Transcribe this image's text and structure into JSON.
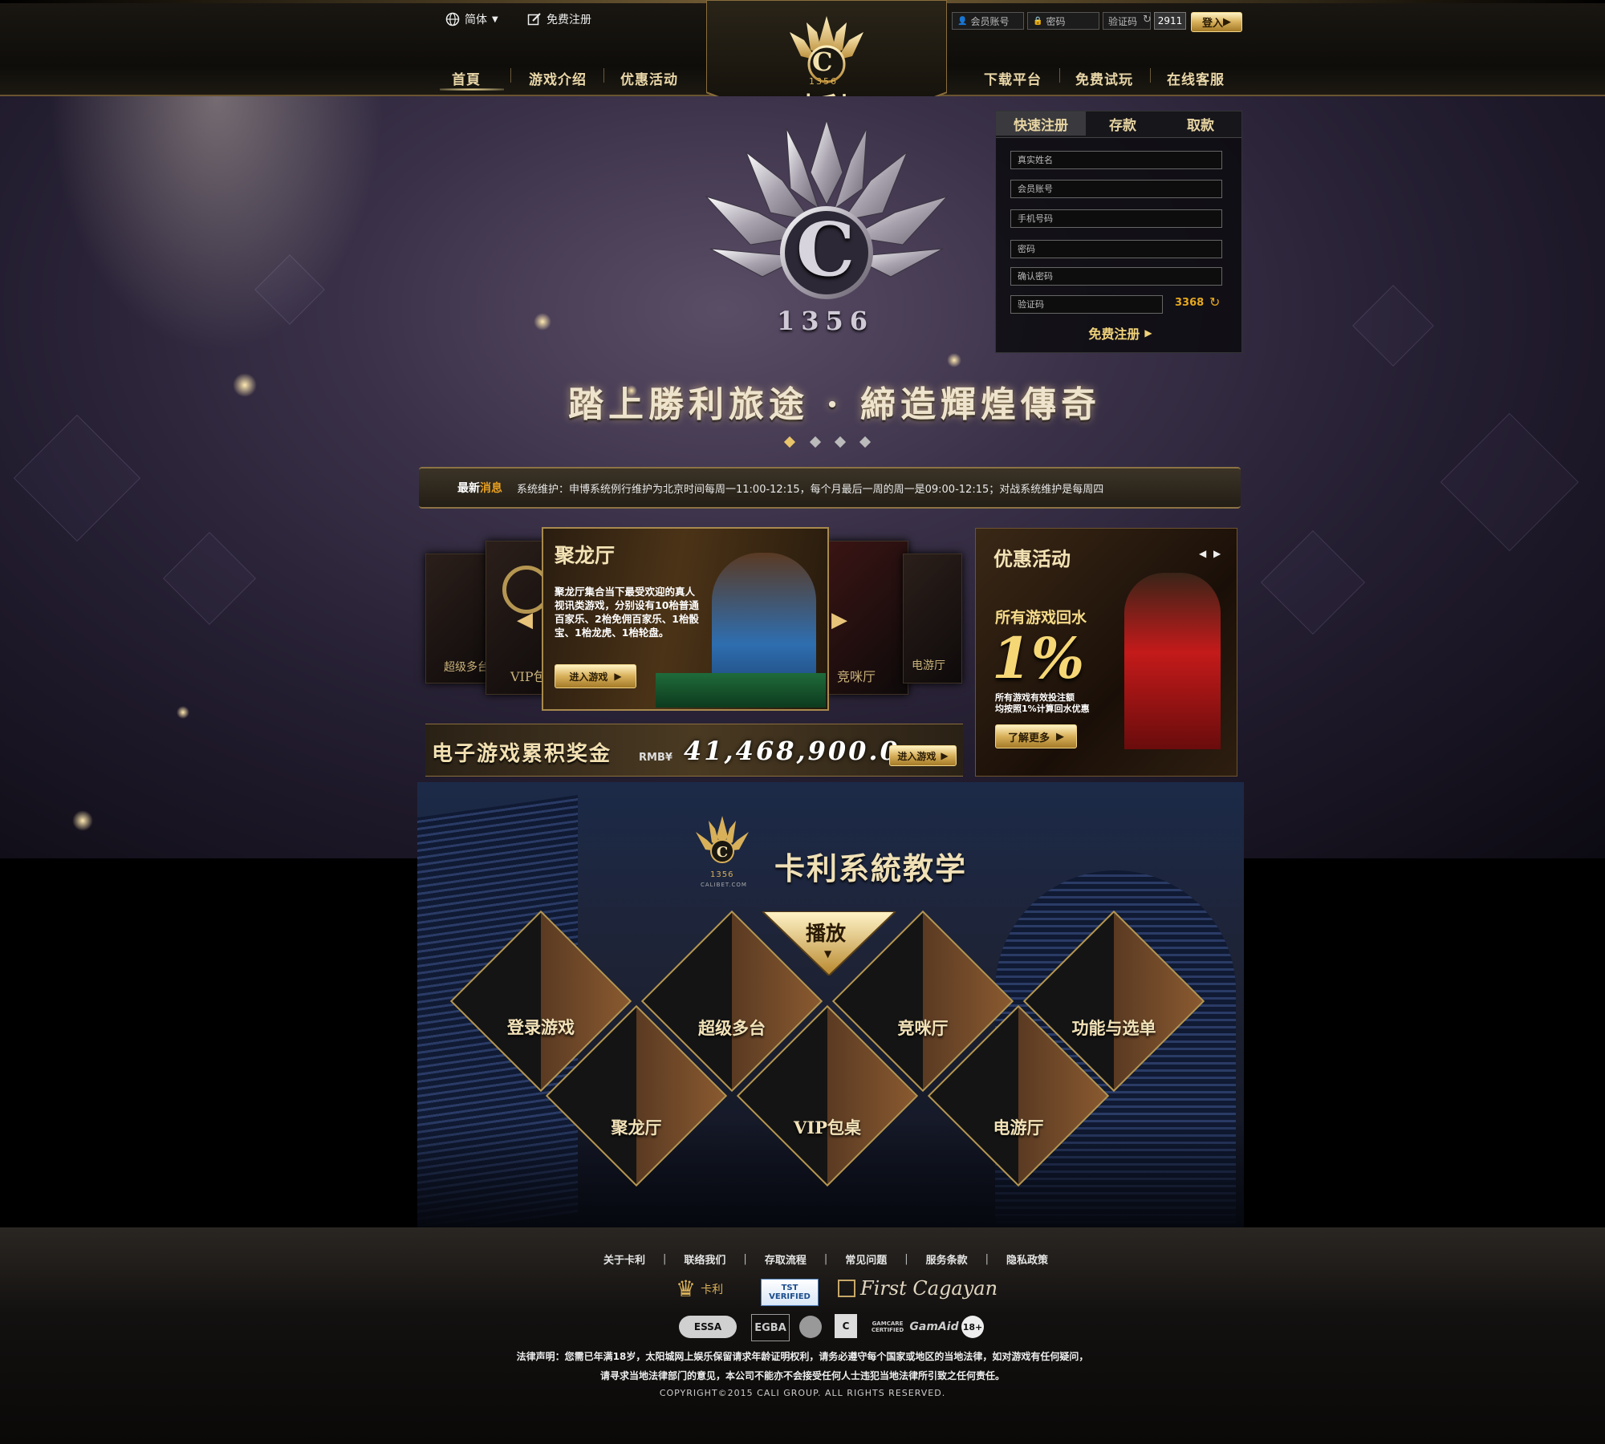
{
  "topbar": {
    "language": "简体",
    "register_link": "免费注册",
    "login": {
      "account_placeholder": "会员账号",
      "password_placeholder": "密码",
      "captcha_label": "验证码",
      "captcha_code": "2911",
      "login_button": "登入"
    },
    "nav_left": [
      "首頁",
      "游戏介绍",
      "优惠活动"
    ],
    "nav_right": [
      "下载平台",
      "免费试玩",
      "在线客服"
    ],
    "brand": {
      "name": "卡利",
      "number": "1356",
      "letter": "C"
    }
  },
  "hero": {
    "slogan": "踏上勝利旅途 · 締造輝煌傳奇",
    "logo_number": "1356",
    "logo_letter": "C"
  },
  "register_panel": {
    "tabs": [
      "快速注册",
      "存款",
      "取款"
    ],
    "fields": [
      "真实姓名",
      "会员账号",
      "手机号码",
      "密码",
      "确认密码",
      "验证码"
    ],
    "captcha_code": "3368",
    "submit": "免费注册"
  },
  "news": {
    "label_a": "最新",
    "label_b": "消息",
    "text": "系统维护：申博系统例行维护为北京时间每周一11:00-12:15，每个月最后一周的周一是09:00-12:15；对战系统维护是每周四"
  },
  "games": {
    "featured": {
      "title": "聚龙厅",
      "description": "聚龙厅集合当下最受欢迎的真人视讯类游戏，分别设有10枱普通百家乐、2枱免佣百家乐、1枱骰宝、1枱龙虎、1枱轮盘。",
      "button": "进入游戏"
    },
    "side_cards": [
      "超级多台",
      "VIP包",
      "竞咪厅",
      "电游厅"
    ]
  },
  "jackpot": {
    "title": "电子游戏累积奖金",
    "currency": "RMB¥",
    "amount": "41,468,900.0",
    "button": "进入游戏"
  },
  "promo": {
    "title": "优惠活动",
    "headline": "所有游戏回水",
    "percent": "1%",
    "line1": "所有游戏有效投注额",
    "line2": "均按照1%计算回水优惠",
    "button": "了解更多"
  },
  "tutorial": {
    "title": "卡利系統教学",
    "logo_number": "1356",
    "site": "CALIBET.COM",
    "play_label": "播放",
    "tiles_top": [
      "登录游戏",
      "超级多台",
      "竞咪厅",
      "功能与选单"
    ],
    "tiles_bottom": [
      "聚龙厅",
      "VIP包桌",
      "电游厅"
    ]
  },
  "footer": {
    "links": [
      "关于卡利",
      "联络我们",
      "存取流程",
      "常见问题",
      "服务条款",
      "隐私政策"
    ],
    "partners": [
      "卡利",
      "TST VERIFIED",
      "First Cagayan"
    ],
    "badges": [
      "ESSA",
      "EGBA",
      "GAMCARE CERTIFIED",
      "GamAid",
      "18+"
    ],
    "legal_1": "法律声明：您需已年满18岁，太阳城网上娱乐保留请求年龄证明权利，请务必遵守每个国家或地区的当地法律，如对游戏有任何疑问，",
    "legal_2": "请寻求当地法律部门的意见，本公司不能亦不会接受任何人士违犯当地法律所引致之任何责任。",
    "copyright": "COPYRIGHT©2015 CALI GROUP. ALL RIGHTS RESERVED."
  },
  "colors": {
    "gold": "#d8b05a",
    "gold_light": "#f1d588",
    "accent_orange": "#e8a020"
  }
}
